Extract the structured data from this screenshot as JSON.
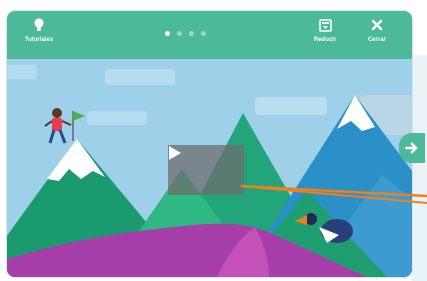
{
  "topbar": {
    "tips_label": "Tutoriales",
    "shrink_label": "Reducir",
    "close_label": "Cerrar",
    "active_step": 1,
    "step_count": 4
  },
  "video": {
    "play_icon": "play-icon"
  },
  "navigation": {
    "next_icon": "arrow-right-icon"
  },
  "colors": {
    "topbar": "#4cb99a",
    "sky": "#9ed0ea",
    "mountain_dark": "#1b9a6f",
    "mountain_light": "#2fb883",
    "ground_purple": "#a53ea8",
    "pointer": "#f07f1d"
  }
}
